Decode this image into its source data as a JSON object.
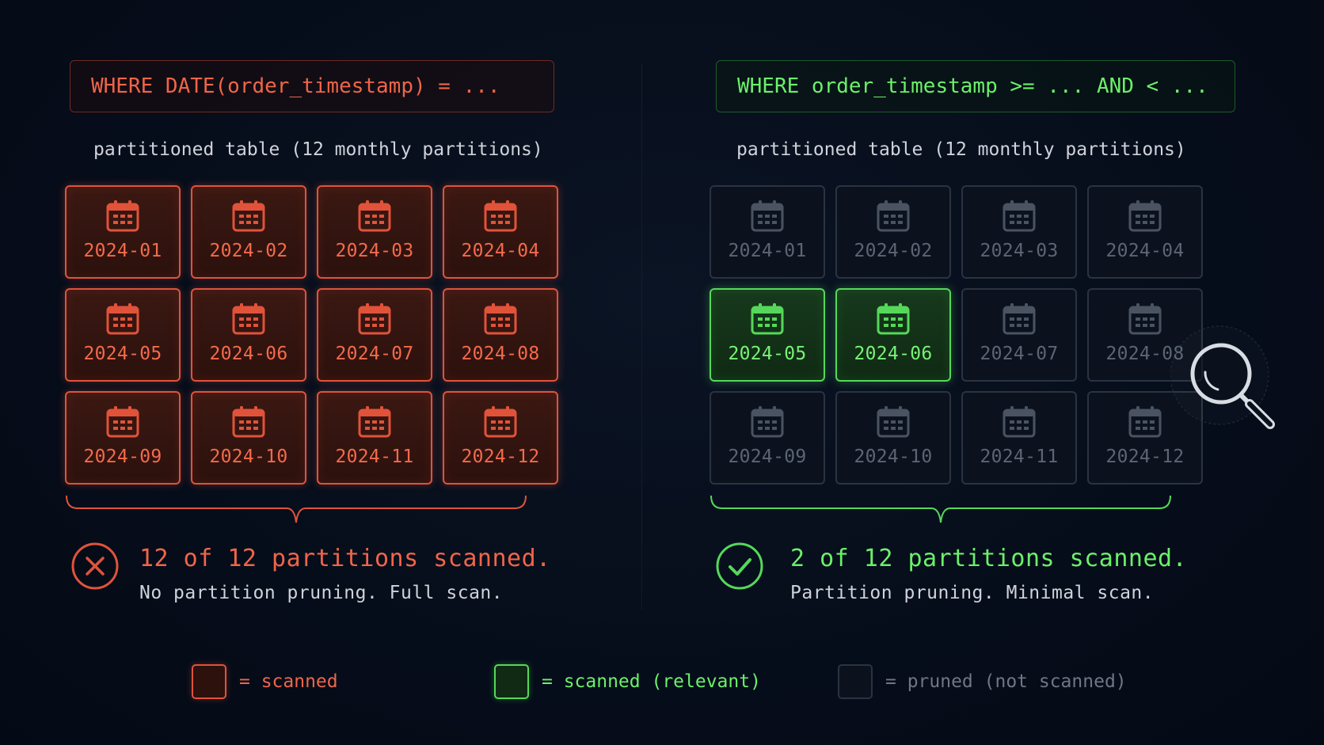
{
  "colors": {
    "scanned": "#e0533a",
    "relevant": "#55d85a",
    "pruned": "#2a3342"
  },
  "left": {
    "query": "WHERE DATE(order_timestamp) = ...",
    "caption": "partitioned table (12 monthly partitions)",
    "partitions": [
      {
        "label": "2024-01",
        "state": "scanned"
      },
      {
        "label": "2024-02",
        "state": "scanned"
      },
      {
        "label": "2024-03",
        "state": "scanned"
      },
      {
        "label": "2024-04",
        "state": "scanned"
      },
      {
        "label": "2024-05",
        "state": "scanned"
      },
      {
        "label": "2024-06",
        "state": "scanned"
      },
      {
        "label": "2024-07",
        "state": "scanned"
      },
      {
        "label": "2024-08",
        "state": "scanned"
      },
      {
        "label": "2024-09",
        "state": "scanned"
      },
      {
        "label": "2024-10",
        "state": "scanned"
      },
      {
        "label": "2024-11",
        "state": "scanned"
      },
      {
        "label": "2024-12",
        "state": "scanned"
      }
    ],
    "status_icon": "x-circle-icon",
    "status_title": "12 of 12 partitions scanned.",
    "status_sub": "No partition pruning. Full scan."
  },
  "right": {
    "query": "WHERE order_timestamp >= ... AND < ...",
    "caption": "partitioned table (12 monthly partitions)",
    "partitions": [
      {
        "label": "2024-01",
        "state": "pruned"
      },
      {
        "label": "2024-02",
        "state": "pruned"
      },
      {
        "label": "2024-03",
        "state": "pruned"
      },
      {
        "label": "2024-04",
        "state": "pruned"
      },
      {
        "label": "2024-05",
        "state": "relevant"
      },
      {
        "label": "2024-06",
        "state": "relevant"
      },
      {
        "label": "2024-07",
        "state": "pruned"
      },
      {
        "label": "2024-08",
        "state": "pruned"
      },
      {
        "label": "2024-09",
        "state": "pruned"
      },
      {
        "label": "2024-10",
        "state": "pruned"
      },
      {
        "label": "2024-11",
        "state": "pruned"
      },
      {
        "label": "2024-12",
        "state": "pruned"
      }
    ],
    "status_icon": "check-circle-icon",
    "status_title": "2 of 12 partitions scanned.",
    "status_sub": "Partition pruning. Minimal scan.",
    "overlay_icon": "magnifier-icon"
  },
  "legend": [
    {
      "text": "= scanned",
      "state": "scanned"
    },
    {
      "text": "= scanned (relevant)",
      "state": "relevant"
    },
    {
      "text": "= pruned (not scanned)",
      "state": "pruned"
    }
  ]
}
